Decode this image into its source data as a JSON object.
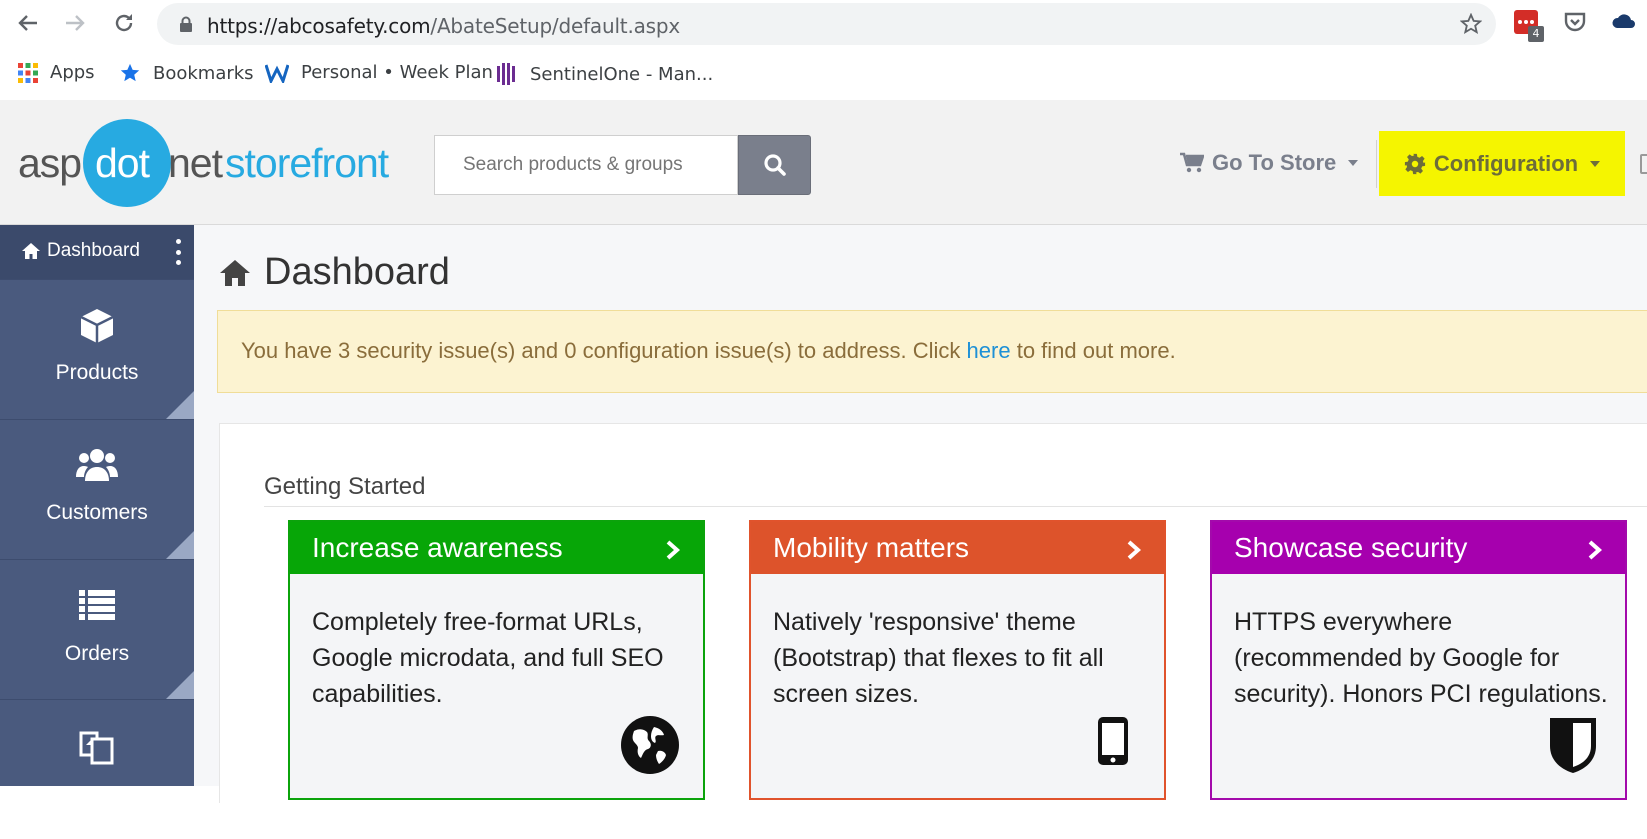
{
  "browser": {
    "url_host": "https://abcosafety.com",
    "url_path": "/AbateSetup/default.aspx",
    "extension_badge": "4",
    "bookmarks": [
      {
        "label": "Apps",
        "icon": "apps-grid-icon"
      },
      {
        "label": "Bookmarks",
        "icon": "star-icon"
      },
      {
        "label": "Personal • Week Plan",
        "icon": "w-logo-icon"
      },
      {
        "label": "SentinelOne - Man...",
        "icon": "sentinelone-icon"
      }
    ]
  },
  "header": {
    "logo": {
      "part1": "asp",
      "part2": "dot",
      "part3": "net",
      "part4": "storefront"
    },
    "search_placeholder": "Search products & groups",
    "go_to_store": "Go To Store",
    "configuration": "Configuration",
    "config_highlight_color": "#f5f500"
  },
  "sidebar": {
    "top_label": "Dashboard",
    "items": [
      {
        "label": "Products",
        "icon": "cube-icon"
      },
      {
        "label": "Customers",
        "icon": "users-icon"
      },
      {
        "label": "Orders",
        "icon": "list-icon"
      },
      {
        "label": "",
        "icon": "copy-icon"
      }
    ]
  },
  "main": {
    "title": "Dashboard",
    "alert": {
      "text_before": "You have 3 security issue(s) and 0 configuration issue(s) to address. Click ",
      "link": "here",
      "text_after": " to find out more."
    },
    "section_title": "Getting Started",
    "cards": [
      {
        "title": "Increase awareness",
        "body": "Completely free-format URLs, Google microdata, and full SEO capabilities.",
        "icon": "globe-icon",
        "color": "#07a607"
      },
      {
        "title": "Mobility matters",
        "body": "Natively 'responsive' theme (Bootstrap) that flexes to fit all screen sizes.",
        "icon": "mobile-phone-icon",
        "color": "#dd532b"
      },
      {
        "title": "Showcase security",
        "body": "HTTPS everywhere (recommended by Google for security). Honors PCI regulations.",
        "icon": "shield-icon",
        "color": "#a600ae"
      }
    ]
  }
}
